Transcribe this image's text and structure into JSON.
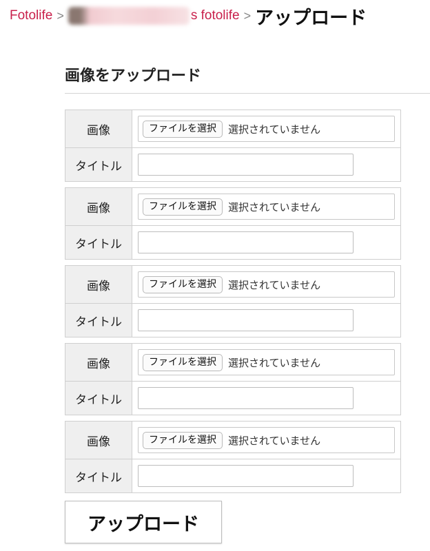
{
  "breadcrumb": {
    "root": "Fotolife",
    "separator": ">",
    "user_suffix": "s fotolife",
    "current": "アップロード"
  },
  "section_title": "画像をアップロード",
  "rows": [
    {
      "image_label": "画像",
      "file_button": "ファイルを選択",
      "file_status": "選択されていません",
      "title_label": "タイトル",
      "title_value": ""
    },
    {
      "image_label": "画像",
      "file_button": "ファイルを選択",
      "file_status": "選択されていません",
      "title_label": "タイトル",
      "title_value": ""
    },
    {
      "image_label": "画像",
      "file_button": "ファイルを選択",
      "file_status": "選択されていません",
      "title_label": "タイトル",
      "title_value": ""
    },
    {
      "image_label": "画像",
      "file_button": "ファイルを選択",
      "file_status": "選択されていません",
      "title_label": "タイトル",
      "title_value": ""
    },
    {
      "image_label": "画像",
      "file_button": "ファイルを選択",
      "file_status": "選択されていません",
      "title_label": "タイトル",
      "title_value": ""
    }
  ],
  "submit_label": "アップロード",
  "colors": {
    "link": "#c81e4a",
    "header_bg": "#efefef",
    "border": "#cfcfcf"
  }
}
